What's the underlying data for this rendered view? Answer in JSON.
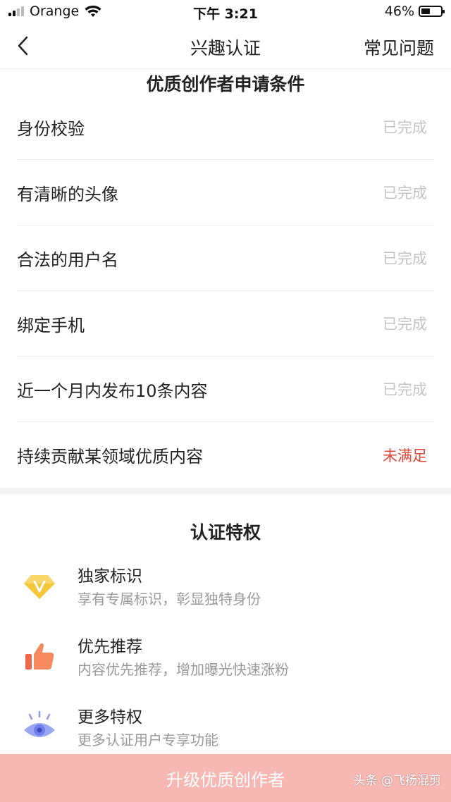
{
  "status_bar": {
    "carrier": "Orange",
    "time": "下午 3:21",
    "battery_text": "46%",
    "battery_level": 0.46
  },
  "nav": {
    "title": "兴趣认证",
    "faq_label": "常见问题"
  },
  "conditions": {
    "title": "优质创作者申请条件",
    "items": [
      {
        "label": "身份校验",
        "status": "已完成"
      },
      {
        "label": "有清晰的头像",
        "status": "已完成"
      },
      {
        "label": "合法的用户名",
        "status": "已完成"
      },
      {
        "label": "绑定手机",
        "status": "已完成"
      },
      {
        "label": "近一个月内发布10条内容",
        "status": "已完成"
      },
      {
        "label": "持续贡献某领域优质内容",
        "status": "未满足"
      }
    ]
  },
  "privileges": {
    "title": "认证特权",
    "items": [
      {
        "icon": "diamond-v-icon",
        "title": "独家标识",
        "desc": "享有专属标识，彰显独特身份"
      },
      {
        "icon": "thumbs-up-icon",
        "title": "优先推荐",
        "desc": "内容优先推荐，增加曝光快速涨粉"
      },
      {
        "icon": "eye-icon",
        "title": "更多特权",
        "desc": "更多认证用户专享功能"
      }
    ]
  },
  "cta": {
    "label": "升级优质创作者"
  },
  "watermark": "头条 @飞扬混剪",
  "colors": {
    "unmet": "#e0453a",
    "done": "#c4c4c4",
    "cta_bg": "#f7b8b3"
  }
}
